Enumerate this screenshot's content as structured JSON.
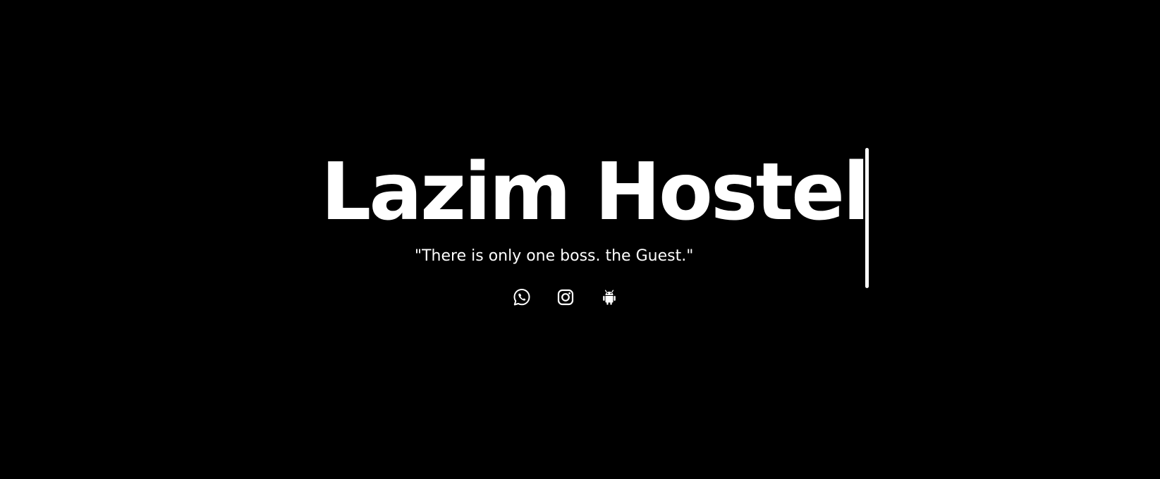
{
  "hero": {
    "title": "Lazim Hostel",
    "tagline": "\"There is only one boss. the Guest.\""
  },
  "social_links": [
    {
      "icon": "whatsapp-icon"
    },
    {
      "icon": "instagram-icon"
    },
    {
      "icon": "android-icon"
    }
  ],
  "colors": {
    "background": "#000000",
    "text": "#ffffff"
  }
}
